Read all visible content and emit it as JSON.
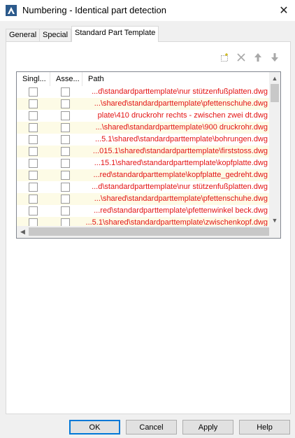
{
  "window": {
    "title": "Numbering - Identical part detection",
    "close_glyph": "✕"
  },
  "tabs": [
    {
      "label": "General"
    },
    {
      "label": "Special"
    },
    {
      "label": "Standard Part Template"
    }
  ],
  "toolbar": {
    "icons": [
      "new-item-icon",
      "delete-icon",
      "move-up-icon",
      "move-down-icon"
    ]
  },
  "grid": {
    "columns": [
      "Singl...",
      "Asse...",
      "Path"
    ],
    "rows": [
      {
        "path": "...d\\standardparttemplate\\nur stützenfußplatten.dwg"
      },
      {
        "path": "...\\shared\\standardparttemplate\\pfettenschuhe.dwg"
      },
      {
        "path": "plate\\410 druckrohr rechts - zwischen zwei dt.dwg"
      },
      {
        "path": "...\\shared\\standardparttemplate\\900 druckrohr.dwg"
      },
      {
        "path": "...5.1\\shared\\standardparttemplate\\bohrungen.dwg"
      },
      {
        "path": "...015.1\\shared\\standardparttemplate\\firststoss.dwg"
      },
      {
        "path": "...15.1\\shared\\standardparttemplate\\kopfplatte.dwg"
      },
      {
        "path": "...red\\standardparttemplate\\kopfplatte_gedreht.dwg"
      },
      {
        "path": "...d\\standardparttemplate\\nur stützenfußplatten.dwg"
      },
      {
        "path": "...\\shared\\standardparttemplate\\pfettenschuhe.dwg"
      },
      {
        "path": "...red\\standardparttemplate\\pfettenwinkel beck.dwg"
      },
      {
        "path": "...5.1\\shared\\standardparttemplate\\zwischenkopf.dwg"
      }
    ]
  },
  "buttons": {
    "ok": "OK",
    "cancel": "Cancel",
    "apply": "Apply",
    "help": "Help"
  },
  "colors": {
    "path_text": "#e31313",
    "alt_row": "#fdfbe6",
    "accent": "#0078d7"
  }
}
